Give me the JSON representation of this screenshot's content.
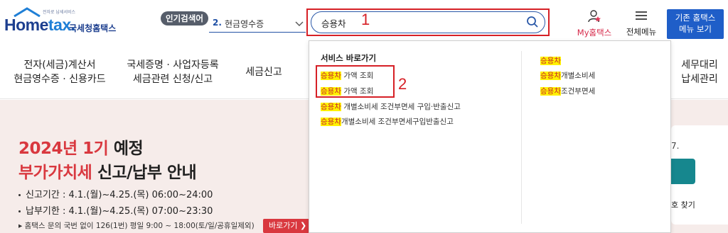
{
  "header": {
    "logo": {
      "slogan": "전자로 납세서비스",
      "word_home": "Home",
      "word_tax": "tax.",
      "korean": "국세청홈택스"
    },
    "popular": {
      "badge": "인기검색어",
      "rank": "2.",
      "term": "현금영수증"
    },
    "search": {
      "value": "승용차",
      "annotation": "1"
    },
    "my_hometax": "My홈택스",
    "all_menu": "전체메뉴",
    "old_home": {
      "line1": "기존 홈택스",
      "line2": "메뉴 보기"
    }
  },
  "nav": {
    "item1": {
      "line1": "전자(세금)계산서",
      "line2": "현금영수증 · 신용카드"
    },
    "item2": {
      "line1": "국세증명 · 사업자등록",
      "line2": "세금관련 신청/신고"
    },
    "item3": {
      "line1": "세금신고"
    },
    "item4": {
      "line1": "세무대리",
      "line2": "납세관리"
    }
  },
  "dropdown": {
    "left_header": "서비스 바로가기",
    "annotation": "2",
    "left_links": [
      {
        "hl": "승용차",
        "rest": " 가액 조회"
      },
      {
        "hl": "승용차",
        "rest": " 가액 조회"
      },
      {
        "hl": "승용차",
        "rest": " 개별소비세 조건부면세 구입·반출신고"
      },
      {
        "hl": "승용차",
        "rest": "개별소비세 조건부면세구입반출신고"
      }
    ],
    "right_links": [
      {
        "hl": "승용차",
        "rest": ""
      },
      {
        "hl": "승용차",
        "rest": "개별소비세"
      },
      {
        "hl": "승용차",
        "rest": "조건부면세"
      }
    ]
  },
  "banner": {
    "title1_red": "2024년 1기 ",
    "title1_dark": "예정",
    "title2_red": "부가가치세 ",
    "title2_dark": "신고/납부 안내",
    "line1": "신고기간 : 4.1.(월)~4.25.(목) 06:00~24:00",
    "line2": "납부기한 : 4.1.(월)~4.25.(목) 07:00~23:30",
    "note": "▸ 홈택스 문의 국번 없이 126(1번) 평일 9:00 ~ 18:00(토/일/공휴일제외)",
    "go_button": "바로가기 ❯",
    "side_small": "7.",
    "side_find": "호 찾기"
  },
  "colors": {
    "brand_blue": "#1d3f8f",
    "highlight": "#fff200",
    "annotation_red": "#d62026",
    "banner_bg": "#f6ecea",
    "button_blue": "#1f5ec8"
  }
}
